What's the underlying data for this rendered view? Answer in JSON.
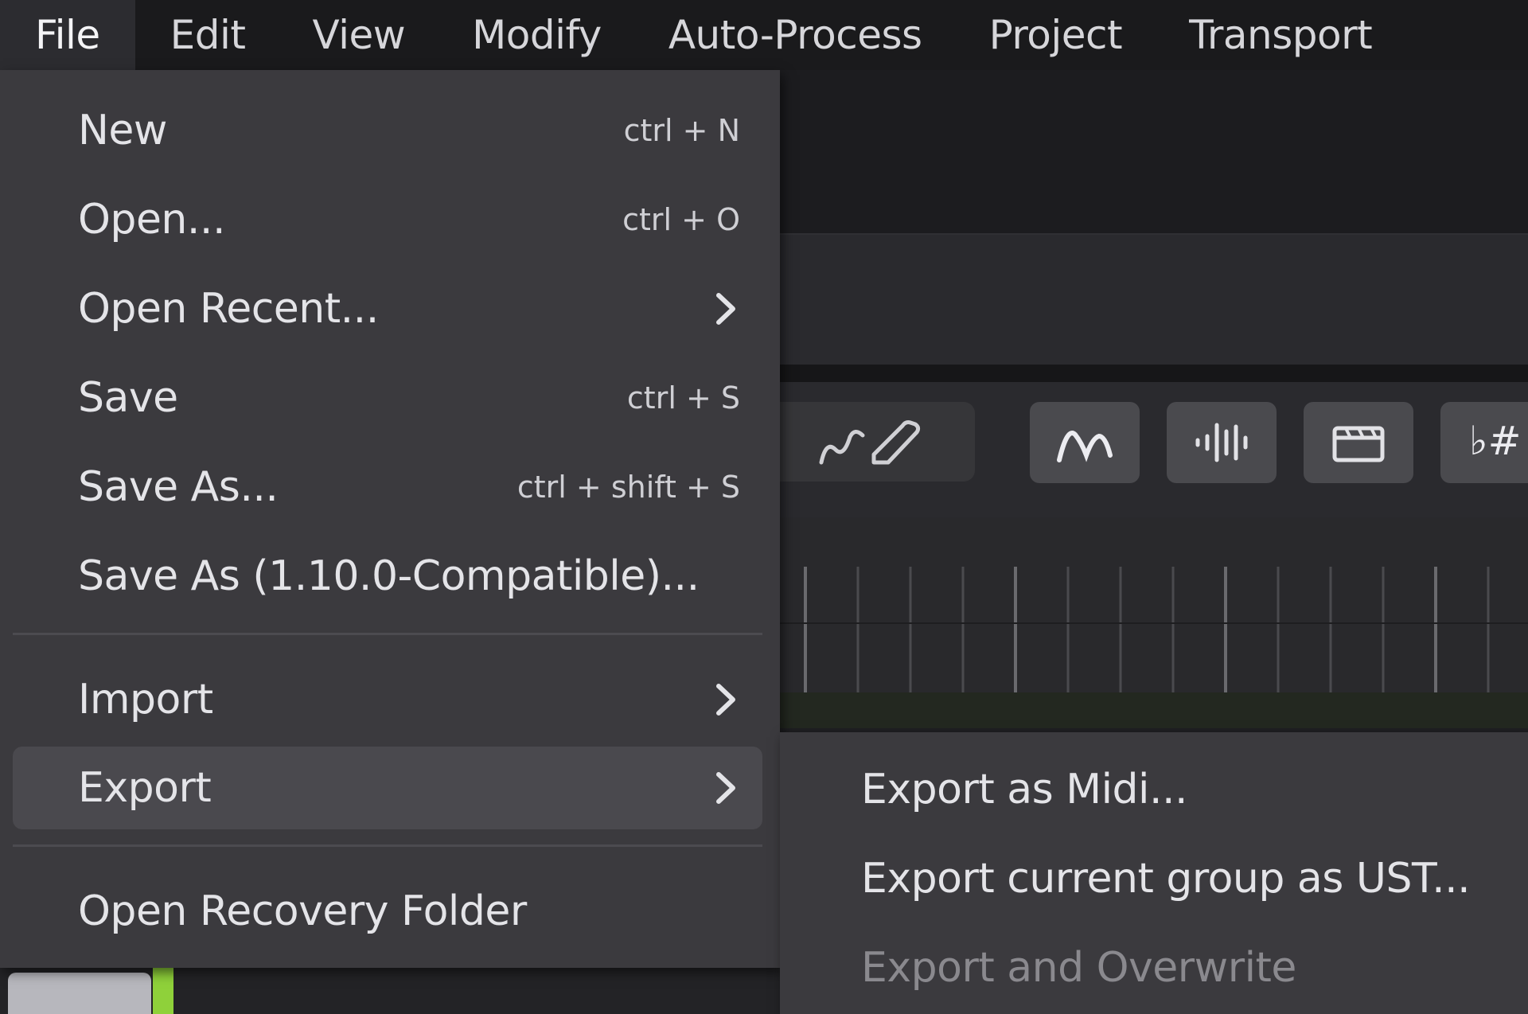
{
  "menubar": {
    "items": [
      {
        "label": "File",
        "active": true
      },
      {
        "label": "Edit"
      },
      {
        "label": "View"
      },
      {
        "label": "Modify"
      },
      {
        "label": "Auto-Process"
      },
      {
        "label": "Project"
      },
      {
        "label": "Transport"
      }
    ]
  },
  "toolbar": {
    "icons": [
      "curve-draw-icon",
      "pitch-curve-icon",
      "waveform-icon",
      "clapperboard-icon",
      "flat-sharp-icon"
    ],
    "tool_flat_sharp_label": "♭#"
  },
  "file_menu": {
    "items": [
      {
        "label": "New",
        "shortcut": "ctrl + N"
      },
      {
        "label": "Open...",
        "shortcut": "ctrl + O"
      },
      {
        "label": "Open Recent...",
        "submenu": true
      },
      {
        "label": "Save",
        "shortcut": "ctrl + S"
      },
      {
        "label": "Save As...",
        "shortcut": "ctrl + shift + S"
      },
      {
        "label": "Save As (1.10.0-Compatible)..."
      },
      {
        "label": "Import",
        "submenu": true
      },
      {
        "label": "Export",
        "submenu": true,
        "highlighted": true
      },
      {
        "label": "Open Recovery Folder"
      }
    ]
  },
  "export_submenu": {
    "items": [
      {
        "label": "Export as Midi..."
      },
      {
        "label": "Export current group as UST..."
      },
      {
        "label": "Export and Overwrite",
        "disabled": true
      }
    ]
  },
  "colors": {
    "menubar_bg": "#1a1a1c",
    "menu_bg": "#3b3a3e",
    "highlight_bg": "#4a494e",
    "text": "#e4e4e8",
    "disabled_text": "#8a898e",
    "accent_green": "#8fd13a"
  }
}
